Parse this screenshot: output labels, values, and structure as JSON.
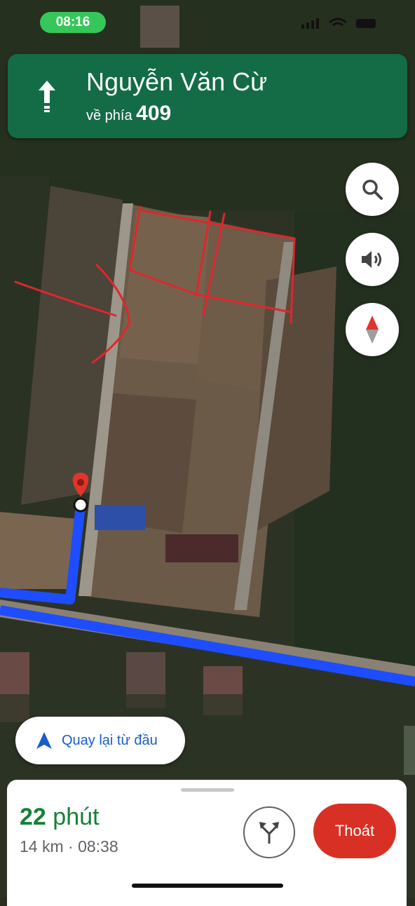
{
  "status_bar": {
    "time": "08:16"
  },
  "navigation": {
    "street_name": "Nguyễn Văn Cừ",
    "toward_prefix": "về phía",
    "toward_route": "409",
    "maneuver_icon": "straight-arrow-icon"
  },
  "map_controls": {
    "search_icon": "search-icon",
    "sound_icon": "volume-icon",
    "compass_icon": "compass-icon"
  },
  "recenter": {
    "label": "Quay lại từ đầu",
    "icon": "navigation-arrow-icon"
  },
  "trip": {
    "duration_value": "22",
    "duration_unit": "phút",
    "distance_eta": "14 km · 08:38",
    "routes_icon": "alternate-routes-icon",
    "exit_label": "Thoát"
  },
  "colors": {
    "banner": "#146c47",
    "route": "#1e4dff",
    "pin": "#e0352b",
    "eta_green": "#188038",
    "exit_red": "#d93025",
    "recenter_blue": "#1a5dc9"
  }
}
